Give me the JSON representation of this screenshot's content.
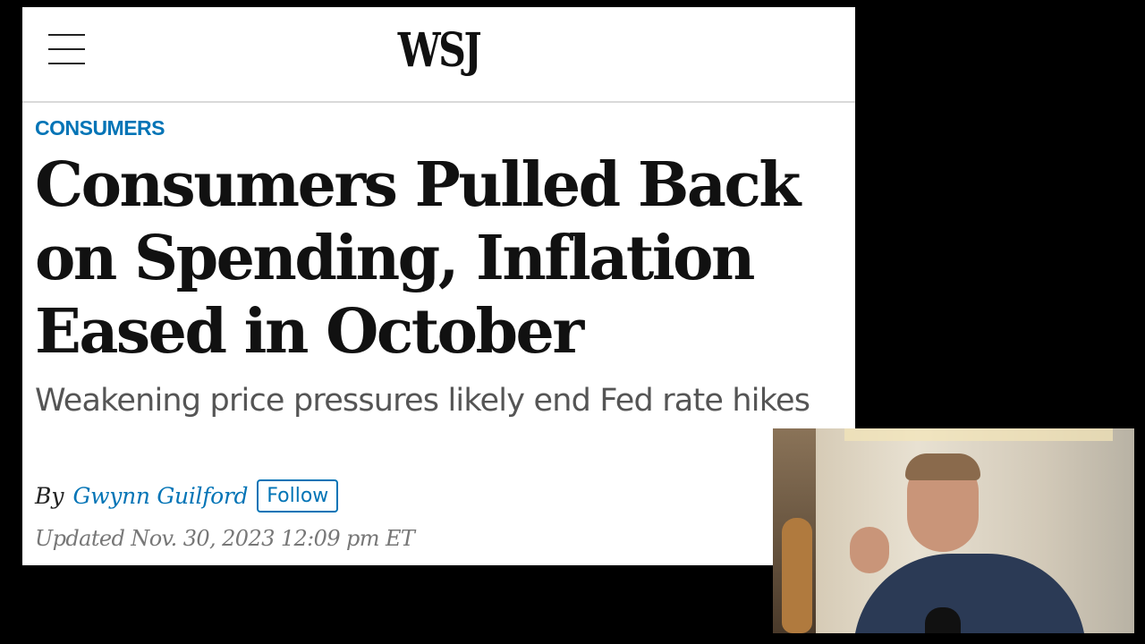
{
  "header": {
    "logo": "WSJ",
    "menu_icon": "hamburger-menu-icon"
  },
  "article": {
    "section": "CONSUMERS",
    "headline": "Consumers Pulled Back on Spending, Inflation Eased in October",
    "subheadline": "Weakening price pressures likely end Fed rate hikes",
    "byline": {
      "prefix": "By",
      "author": "Gwynn Guilford",
      "follow_label": "Follow"
    },
    "updated": "Updated Nov. 30, 2023 12:09 pm ET"
  },
  "colors": {
    "accent": "#0274b6",
    "headline": "#111111",
    "subheadline": "#555555",
    "timestamp": "#777777"
  }
}
